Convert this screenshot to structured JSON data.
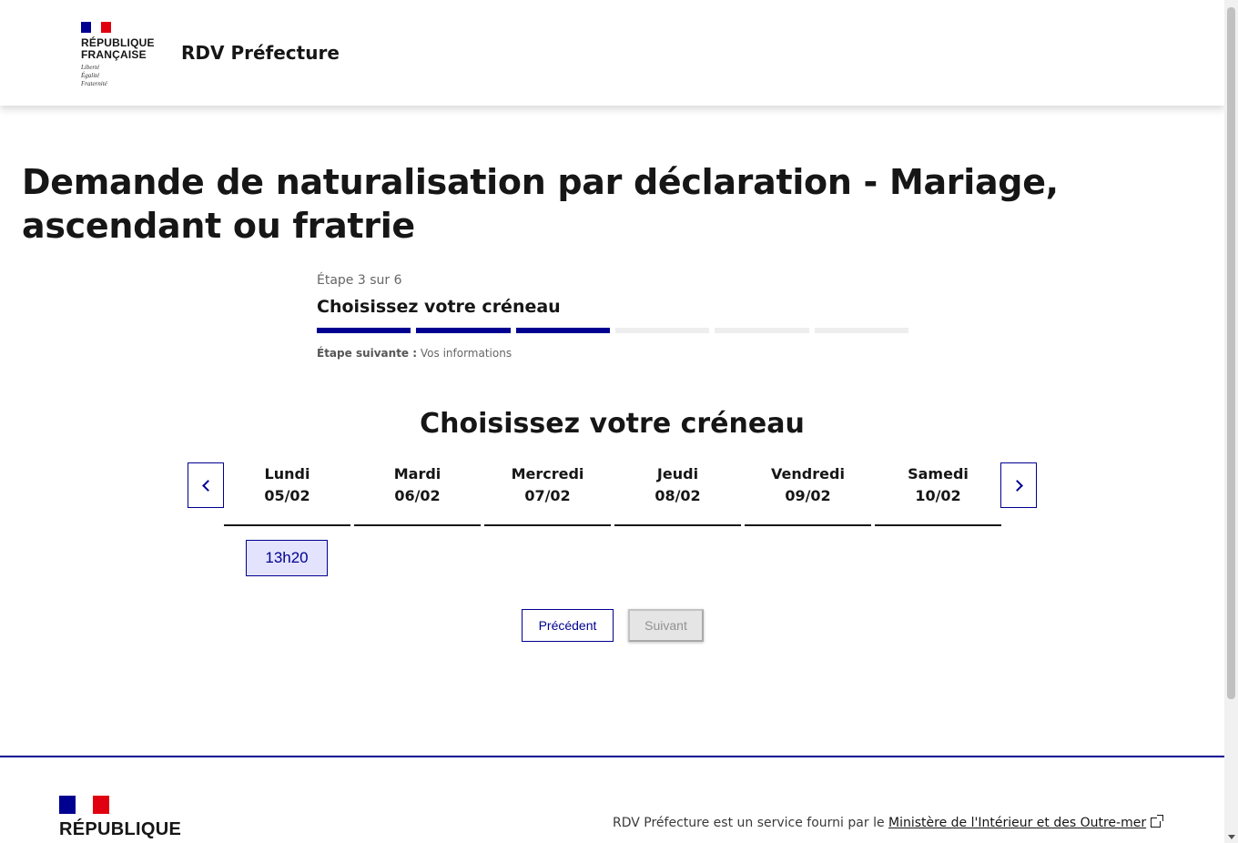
{
  "header": {
    "logo_line1": "RÉPUBLIQUE",
    "logo_line2": "FRANÇAISE",
    "devise1": "Liberté",
    "devise2": "Égalité",
    "devise3": "Fraternité",
    "service_name": "RDV Préfecture"
  },
  "page": {
    "title": "Demande de naturalisation par déclaration - Mariage, ascendant ou fratrie"
  },
  "stepper": {
    "count": "Étape 3 sur 6",
    "title": "Choisissez votre créneau",
    "current_step": 3,
    "total_steps": 6,
    "next_label": "Étape suivante :",
    "next_value": "Vos informations"
  },
  "calendar": {
    "title": "Choisissez votre créneau",
    "days": [
      {
        "name": "Lundi",
        "date": "05/02"
      },
      {
        "name": "Mardi",
        "date": "06/02"
      },
      {
        "name": "Mercredi",
        "date": "07/02"
      },
      {
        "name": "Jeudi",
        "date": "08/02"
      },
      {
        "name": "Vendredi",
        "date": "09/02"
      },
      {
        "name": "Samedi",
        "date": "10/02"
      }
    ],
    "slots": [
      "13h20"
    ],
    "prev_icon": "chevron-left-icon",
    "next_icon": "chevron-right-icon"
  },
  "actions": {
    "previous_label": "Précédent",
    "next_label": "Suivant"
  },
  "footer": {
    "logo_line1": "RÉPUBLIQUE",
    "description": "RDV Préfecture est un service fourni par le ",
    "link_text": "Ministère de l'Intérieur et des Outre-mer",
    "link_icon": "external-link-icon"
  },
  "colors": {
    "primary": "#000091",
    "flag_red": "#e1000f",
    "slot_bg": "#e3e3fd",
    "disabled_bg": "#e5e5e5"
  }
}
